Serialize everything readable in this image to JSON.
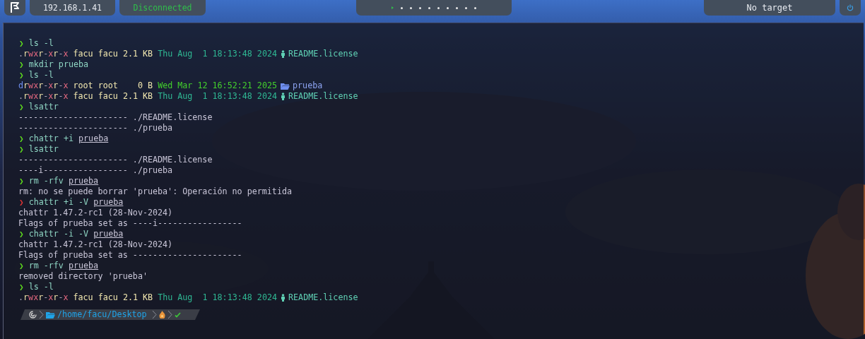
{
  "top_bar": {
    "ip": "192.168.1.41",
    "connection": "Disconnected",
    "workspaces": [
      {
        "selected": true
      },
      {
        "selected": false
      },
      {
        "selected": false
      },
      {
        "selected": false
      },
      {
        "selected": false
      },
      {
        "selected": false
      },
      {
        "selected": false
      },
      {
        "selected": false
      },
      {
        "selected": false
      },
      {
        "selected": false
      }
    ],
    "target": "No target"
  },
  "terminal": {
    "lines": [
      {
        "kind": "prompt",
        "symbol": "❯",
        "failed": false,
        "command": "ls -l"
      },
      {
        "kind": "entry",
        "perms": ".rwxr-xr-x",
        "user": "facu",
        "group": "facu",
        "size": "2.1 KB",
        "date": "Thu Aug  1 18:13:48 2024",
        "color": "#2fb893",
        "is_directory": false,
        "name": "README.license"
      },
      {
        "kind": "prompt",
        "symbol": "❯",
        "failed": false,
        "command": "mkdir prueba"
      },
      {
        "kind": "prompt",
        "symbol": "❯",
        "failed": false,
        "command": "ls -l"
      },
      {
        "kind": "entry",
        "perms": "drwxr-xr-x",
        "user": "root",
        "group": "root",
        "size": "0 B",
        "date": "Wed Mar 12 16:52:21 2025",
        "color": "#43d12c",
        "is_directory": true,
        "name": "prueba"
      },
      {
        "kind": "entry",
        "perms": ".rwxr-xr-x",
        "user": "facu",
        "group": "facu",
        "size": "2.1 KB",
        "date": "Thu Aug  1 18:13:48 2024",
        "color": "#2fb893",
        "is_directory": false,
        "name": "README.license"
      },
      {
        "kind": "prompt",
        "symbol": "❯",
        "failed": false,
        "command": "lsattr"
      },
      {
        "kind": "output",
        "text": "---------------------- ./README.license"
      },
      {
        "kind": "output",
        "text": "---------------------- ./prueba"
      },
      {
        "kind": "prompt",
        "symbol": "❯",
        "failed": false,
        "command": "chattr +i",
        "path_arg": "prueba"
      },
      {
        "kind": "prompt",
        "symbol": "❯",
        "failed": false,
        "command": "lsattr"
      },
      {
        "kind": "output",
        "text": "---------------------- ./README.license"
      },
      {
        "kind": "output",
        "text": "----i----------------- ./prueba"
      },
      {
        "kind": "prompt",
        "symbol": "❯",
        "failed": false,
        "command": "rm -rfv",
        "path_arg": "prueba"
      },
      {
        "kind": "output",
        "text": "rm: no se puede borrar 'prueba': Operación no permitida"
      },
      {
        "kind": "prompt",
        "symbol": "❯",
        "failed": true,
        "command": "chattr +i -V",
        "path_arg": "prueba"
      },
      {
        "kind": "output",
        "text": "chattr 1.47.2-rc1 (28-Nov-2024)"
      },
      {
        "kind": "output",
        "text": "Flags of prueba set as ----i-----------------"
      },
      {
        "kind": "prompt",
        "symbol": "❯",
        "failed": false,
        "command": "chattr -i -V",
        "path_arg": "prueba"
      },
      {
        "kind": "output",
        "text": "chattr 1.47.2-rc1 (28-Nov-2024)"
      },
      {
        "kind": "output",
        "text": "Flags of prueba set as ----------------------"
      },
      {
        "kind": "prompt",
        "symbol": "❯",
        "failed": false,
        "command": "rm -rfv",
        "path_arg": "prueba"
      },
      {
        "kind": "output",
        "text": "removed directory 'prueba'"
      },
      {
        "kind": "prompt",
        "symbol": "❯",
        "failed": false,
        "command": "ls -l"
      },
      {
        "kind": "entry",
        "perms": ".rwxr-xr-x",
        "user": "facu",
        "group": "facu",
        "size": "2.1 KB",
        "date": "Thu Aug  1 18:13:48 2024",
        "color": "#2fb893",
        "is_directory": false,
        "name": "README.license"
      }
    ],
    "prompt_bar": {
      "path": "/home/facu/Desktop"
    }
  }
}
